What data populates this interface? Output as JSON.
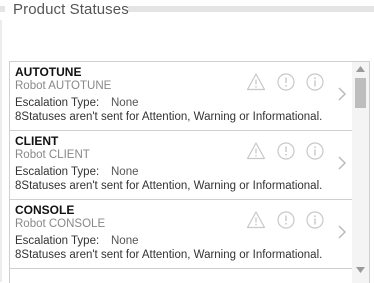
{
  "section": {
    "title": "Product Statuses"
  },
  "escalation_label": "Escalation Type:",
  "products": [
    {
      "name": "AUTOTUNE",
      "robot": "Robot AUTOTUNE",
      "escalation": "None",
      "note": "8Statuses aren't sent for Attention, Warning or Informational."
    },
    {
      "name": "CLIENT",
      "robot": "Robot CLIENT",
      "escalation": "None",
      "note": "8Statuses aren't sent for Attention, Warning or Informational."
    },
    {
      "name": "CONSOLE",
      "robot": "Robot CONSOLE",
      "escalation": "None",
      "note": "8Statuses aren't sent for Attention, Warning or Informational."
    }
  ],
  "icons": {
    "warning": "warning-triangle-icon",
    "attention": "exclamation-circle-icon",
    "info": "info-circle-icon",
    "open": "chevron-right-icon"
  },
  "colors": {
    "icon_gray": "#c8c8c8",
    "border": "#cfcfcf",
    "header_bar": "#e4e4e4"
  }
}
